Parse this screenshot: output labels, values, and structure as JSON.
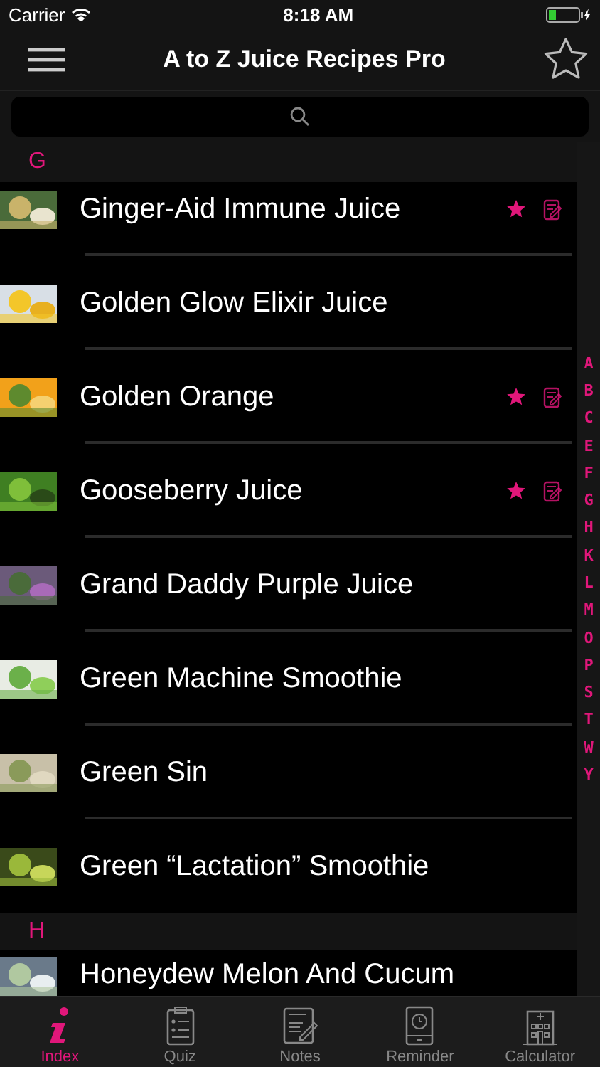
{
  "status_bar": {
    "carrier": "Carrier",
    "time": "8:18 AM"
  },
  "nav": {
    "title": "A to Z Juice Recipes Pro"
  },
  "sections": [
    {
      "letter": "G",
      "recipes": [
        {
          "name": "Ginger-Aid Immune Juice",
          "favorite": true,
          "has_note": true
        },
        {
          "name": "Golden Glow Elixir Juice",
          "favorite": false,
          "has_note": false
        },
        {
          "name": "Golden Orange",
          "favorite": true,
          "has_note": true
        },
        {
          "name": "Gooseberry Juice",
          "favorite": true,
          "has_note": true
        },
        {
          "name": "Grand Daddy Purple Juice",
          "favorite": false,
          "has_note": false
        },
        {
          "name": "Green Machine Smoothie",
          "favorite": false,
          "has_note": false
        },
        {
          "name": "Green Sin",
          "favorite": false,
          "has_note": false
        },
        {
          "name": "Green “Lactation” Smoothie",
          "favorite": false,
          "has_note": false
        }
      ]
    },
    {
      "letter": "H",
      "recipes": [
        {
          "name": "Honeydew Melon And Cucum",
          "favorite": false,
          "has_note": false
        }
      ]
    }
  ],
  "index_letters": [
    "A",
    "B",
    "C",
    "E",
    "F",
    "G",
    "H",
    "K",
    "L",
    "M",
    "O",
    "P",
    "S",
    "T",
    "W",
    "Y"
  ],
  "tabs": [
    {
      "kind": "info",
      "label": "Index",
      "selected": true
    },
    {
      "kind": "quiz",
      "label": "Quiz",
      "selected": false
    },
    {
      "kind": "notes",
      "label": "Notes",
      "selected": false
    },
    {
      "kind": "reminder",
      "label": "Reminder",
      "selected": false
    },
    {
      "kind": "calculator",
      "label": "Calculator",
      "selected": false
    }
  ]
}
